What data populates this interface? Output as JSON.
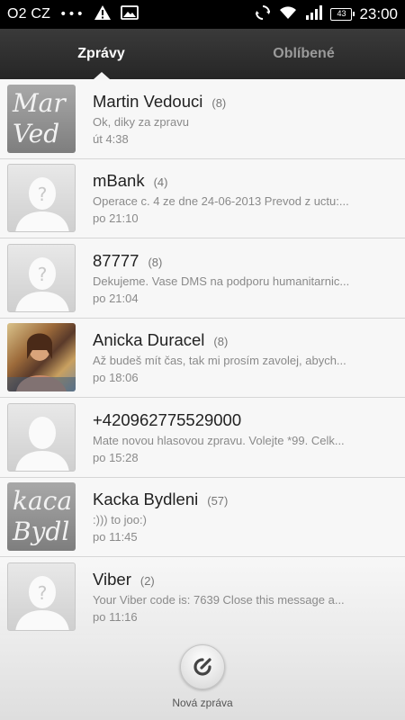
{
  "status_bar": {
    "carrier": "O2 CZ",
    "dots": "•••",
    "battery": "43",
    "time": "23:00"
  },
  "tabs": [
    {
      "label": "Zprávy",
      "active": true
    },
    {
      "label": "Oblíbené",
      "active": false
    }
  ],
  "messages": [
    {
      "name": "Martin Vedouci",
      "count": "(8)",
      "preview": "Ok, diky za zpravu",
      "time": "út 4:38",
      "avatar": "handwriting",
      "avatar_text": "Mar Ved"
    },
    {
      "name": "mBank",
      "count": "(4)",
      "preview": "Operace c. 4 ze dne 24-06-2013 Prevod z uctu:...",
      "time": "po 21:10",
      "avatar": "default"
    },
    {
      "name": "87777",
      "count": "(8)",
      "preview": "Dekujeme. Vase DMS na podporu humanitarnic...",
      "time": "po 21:04",
      "avatar": "default"
    },
    {
      "name": "Anicka Duracel",
      "count": "(8)",
      "preview": "Až budeš mít čas, tak mi prosím zavolej, abych...",
      "time": "po 18:06",
      "avatar": "photo"
    },
    {
      "name": "+420962775529000",
      "count": "",
      "preview": "Mate novou hlasovou zpravu. Volejte *99. Celk...",
      "time": "po 15:28",
      "avatar": "default"
    },
    {
      "name": "Kacka Bydleni",
      "count": "(57)",
      "preview": ":))) to joo:)",
      "time": "po 11:45",
      "avatar": "handwriting",
      "avatar_text": "kaca Bydl"
    },
    {
      "name": "Viber",
      "count": "(2)",
      "preview": "Your Viber code is: 7639 Close this message a...",
      "time": "po 11:16",
      "avatar": "default"
    }
  ],
  "new_message": {
    "label": "Nová zpráva"
  }
}
